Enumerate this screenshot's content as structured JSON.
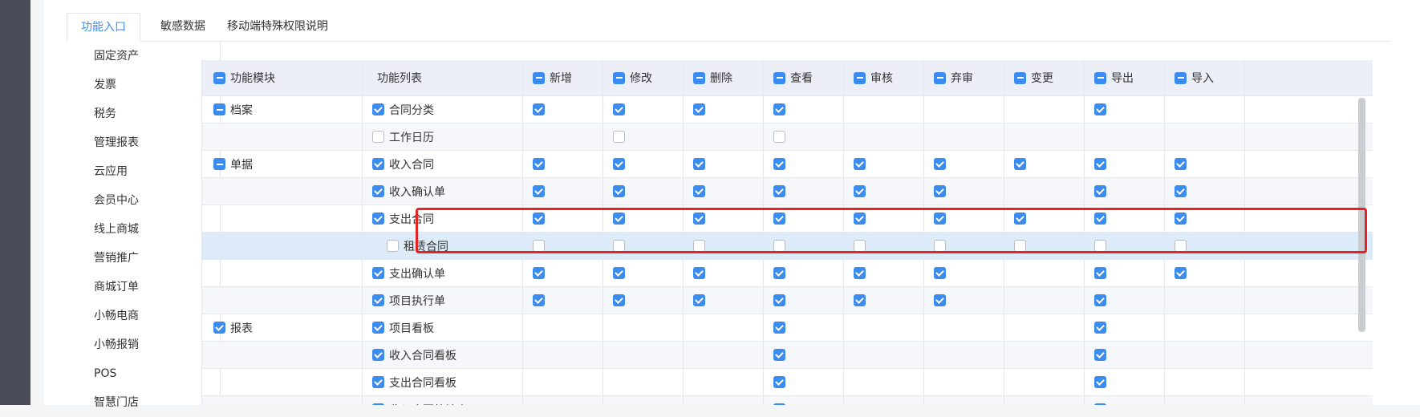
{
  "tabs": [
    {
      "label": "功能入口",
      "active": true
    },
    {
      "label": "敏感数据",
      "active": false
    },
    {
      "label": "移动端特殊权限说明",
      "active": false
    }
  ],
  "side_menu": [
    "固定资产",
    "发票",
    "税务",
    "管理报表",
    "云应用",
    "会员中心",
    "线上商城",
    "营销推广",
    "商城订单",
    "小畅电商",
    "小畅报销",
    "POS",
    "智慧门店"
  ],
  "table": {
    "headers": {
      "module": {
        "label": "功能模块",
        "check": "indet"
      },
      "function": {
        "label": "功能列表"
      },
      "perms": [
        {
          "label": "新增",
          "check": "indet"
        },
        {
          "label": "修改",
          "check": "indet"
        },
        {
          "label": "删除",
          "check": "indet"
        },
        {
          "label": "查看",
          "check": "indet"
        },
        {
          "label": "审核",
          "check": "indet"
        },
        {
          "label": "弃审",
          "check": "indet"
        },
        {
          "label": "变更",
          "check": "indet"
        },
        {
          "label": "导出",
          "check": "indet"
        },
        {
          "label": "导入",
          "check": "indet"
        }
      ]
    },
    "rows": [
      {
        "module": "档案",
        "module_check": "indet",
        "func": "合同分类",
        "func_check": "checked",
        "indent": 0,
        "perms": [
          "checked",
          "checked",
          "checked",
          "checked",
          null,
          null,
          null,
          "checked",
          null
        ]
      },
      {
        "module": "",
        "module_check": null,
        "func": "工作日历",
        "func_check": "unchecked",
        "indent": 0,
        "perms": [
          null,
          "unchecked",
          null,
          "unchecked",
          null,
          null,
          null,
          null,
          null
        ]
      },
      {
        "module": "单据",
        "module_check": "indet",
        "func": "收入合同",
        "func_check": "checked",
        "indent": 0,
        "perms": [
          "checked",
          "checked",
          "checked",
          "checked",
          "checked",
          "checked",
          "checked",
          "checked",
          "checked"
        ]
      },
      {
        "module": "",
        "module_check": null,
        "func": "收入确认单",
        "func_check": "checked",
        "indent": 0,
        "perms": [
          "checked",
          "checked",
          "checked",
          "checked",
          "checked",
          "checked",
          null,
          "checked",
          "checked"
        ]
      },
      {
        "module": "",
        "module_check": null,
        "func": "支出合同",
        "func_check": "checked",
        "indent": 0,
        "perms": [
          "checked",
          "checked",
          "checked",
          "checked",
          "checked",
          "checked",
          "checked",
          "checked",
          "checked"
        ]
      },
      {
        "module": "",
        "module_check": null,
        "func": "租赁合同",
        "func_check": "unchecked",
        "indent": 1,
        "perms": [
          "unchecked",
          "unchecked",
          "unchecked",
          "unchecked",
          "unchecked",
          "unchecked",
          "unchecked",
          "unchecked",
          "unchecked"
        ]
      },
      {
        "module": "",
        "module_check": null,
        "func": "支出确认单",
        "func_check": "checked",
        "indent": 0,
        "perms": [
          "checked",
          "checked",
          "checked",
          "checked",
          "checked",
          "checked",
          null,
          "checked",
          "checked"
        ]
      },
      {
        "module": "",
        "module_check": null,
        "func": "项目执行单",
        "func_check": "checked",
        "indent": 0,
        "perms": [
          "checked",
          "checked",
          "checked",
          "checked",
          "checked",
          "checked",
          null,
          "checked",
          null
        ]
      },
      {
        "module": "报表",
        "module_check": "checked",
        "func": "项目看板",
        "func_check": "checked",
        "indent": 0,
        "perms": [
          null,
          null,
          null,
          "checked",
          null,
          null,
          null,
          "checked",
          null
        ]
      },
      {
        "module": "",
        "module_check": null,
        "func": "收入合同看板",
        "func_check": "checked",
        "indent": 0,
        "perms": [
          null,
          null,
          null,
          "checked",
          null,
          null,
          null,
          "checked",
          null
        ]
      },
      {
        "module": "",
        "module_check": null,
        "func": "支出合同看板",
        "func_check": "checked",
        "indent": 0,
        "perms": [
          null,
          null,
          null,
          "checked",
          null,
          null,
          null,
          "checked",
          null
        ]
      },
      {
        "module": "",
        "module_check": null,
        "func": "收入合同统计表",
        "func_check": "checked",
        "indent": 0,
        "perms": [
          null,
          null,
          null,
          "checked",
          null,
          null,
          null,
          "checked",
          null
        ]
      }
    ]
  },
  "colors": {
    "accent": "#3b8cf0",
    "highlight": "#e52323",
    "selected_row": "#ddeaf8"
  }
}
